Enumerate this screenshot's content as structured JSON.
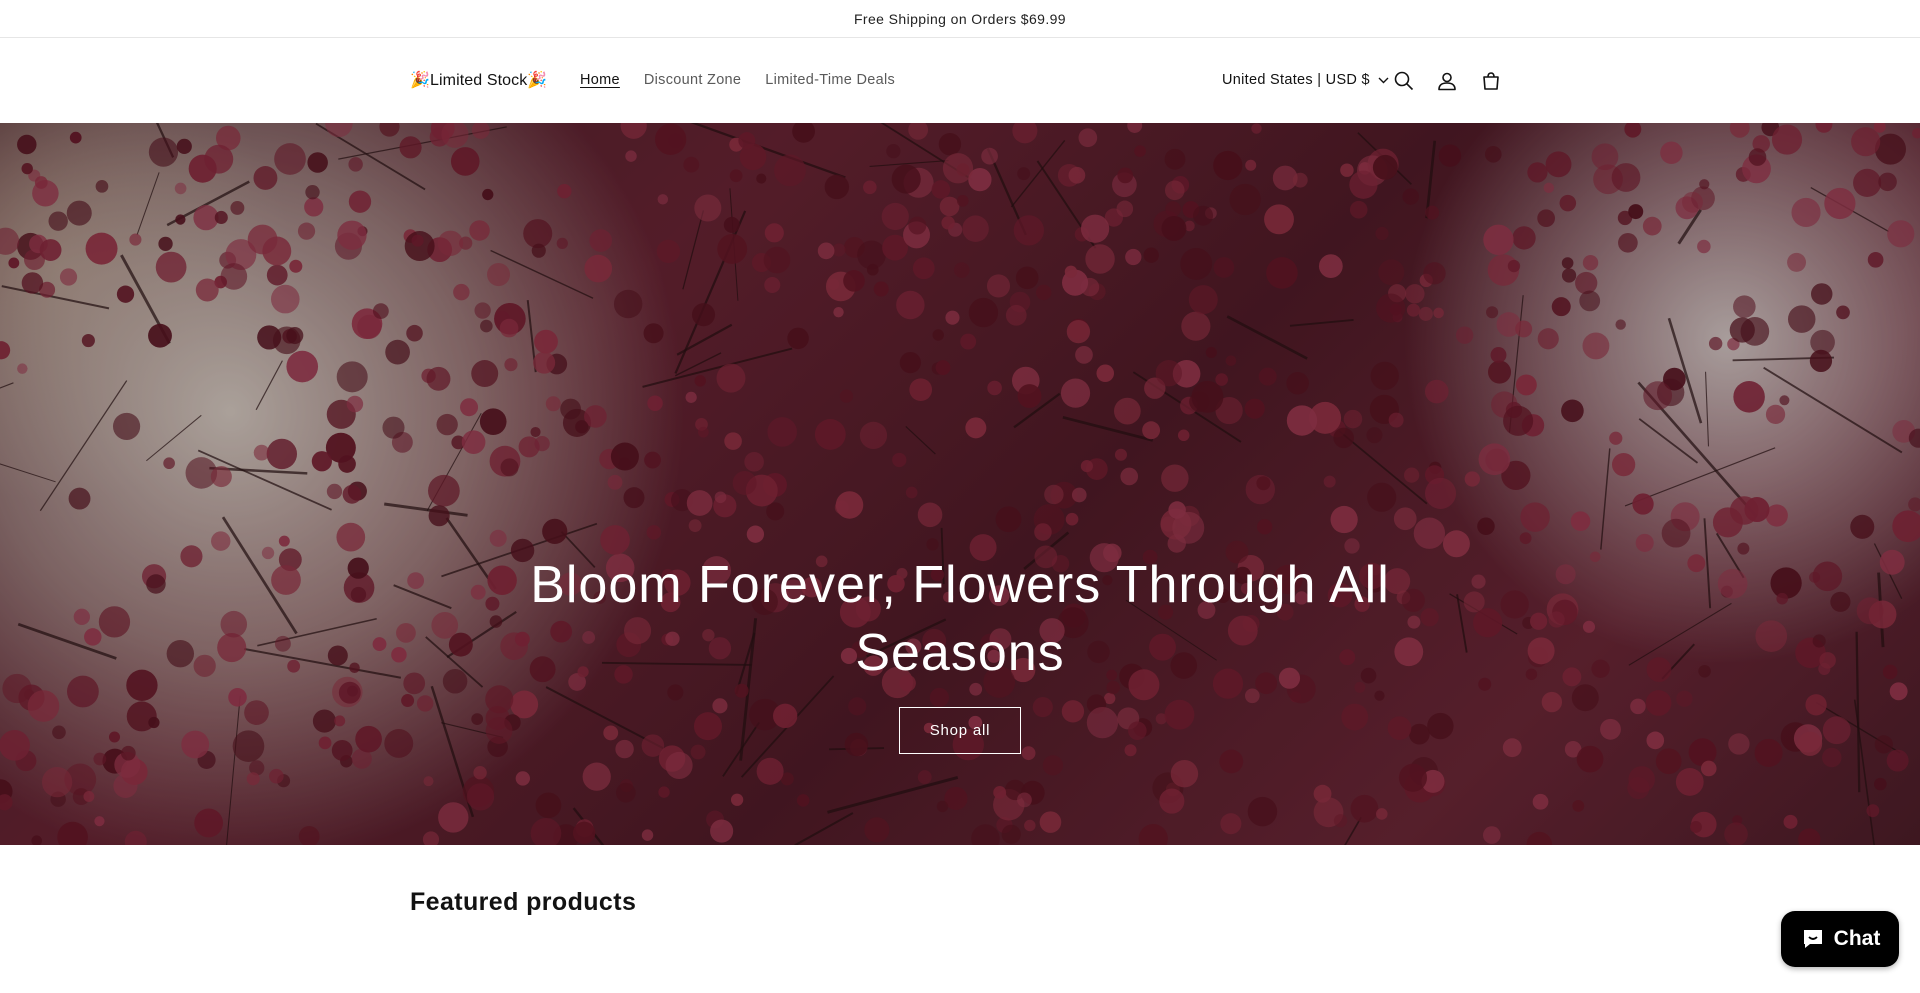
{
  "announcement": {
    "text": "Free Shipping on Orders $69.99"
  },
  "header": {
    "logo": "🎉Limited Stock🎉",
    "nav": [
      {
        "label": "Home",
        "active": true
      },
      {
        "label": "Discount Zone",
        "active": false
      },
      {
        "label": "Limited-Time Deals",
        "active": false
      }
    ],
    "country_selector": "United States | USD $",
    "icons": [
      "search-icon",
      "account-icon",
      "cart-icon"
    ]
  },
  "hero": {
    "title": "Bloom Forever, Flowers Through All Seasons",
    "button_label": "Shop all"
  },
  "featured": {
    "title": "Featured products"
  },
  "chat": {
    "label": "Chat"
  },
  "colors": {
    "hero_flower": "#8a2a3e",
    "chat_bg": "#000000",
    "text": "#121212"
  }
}
